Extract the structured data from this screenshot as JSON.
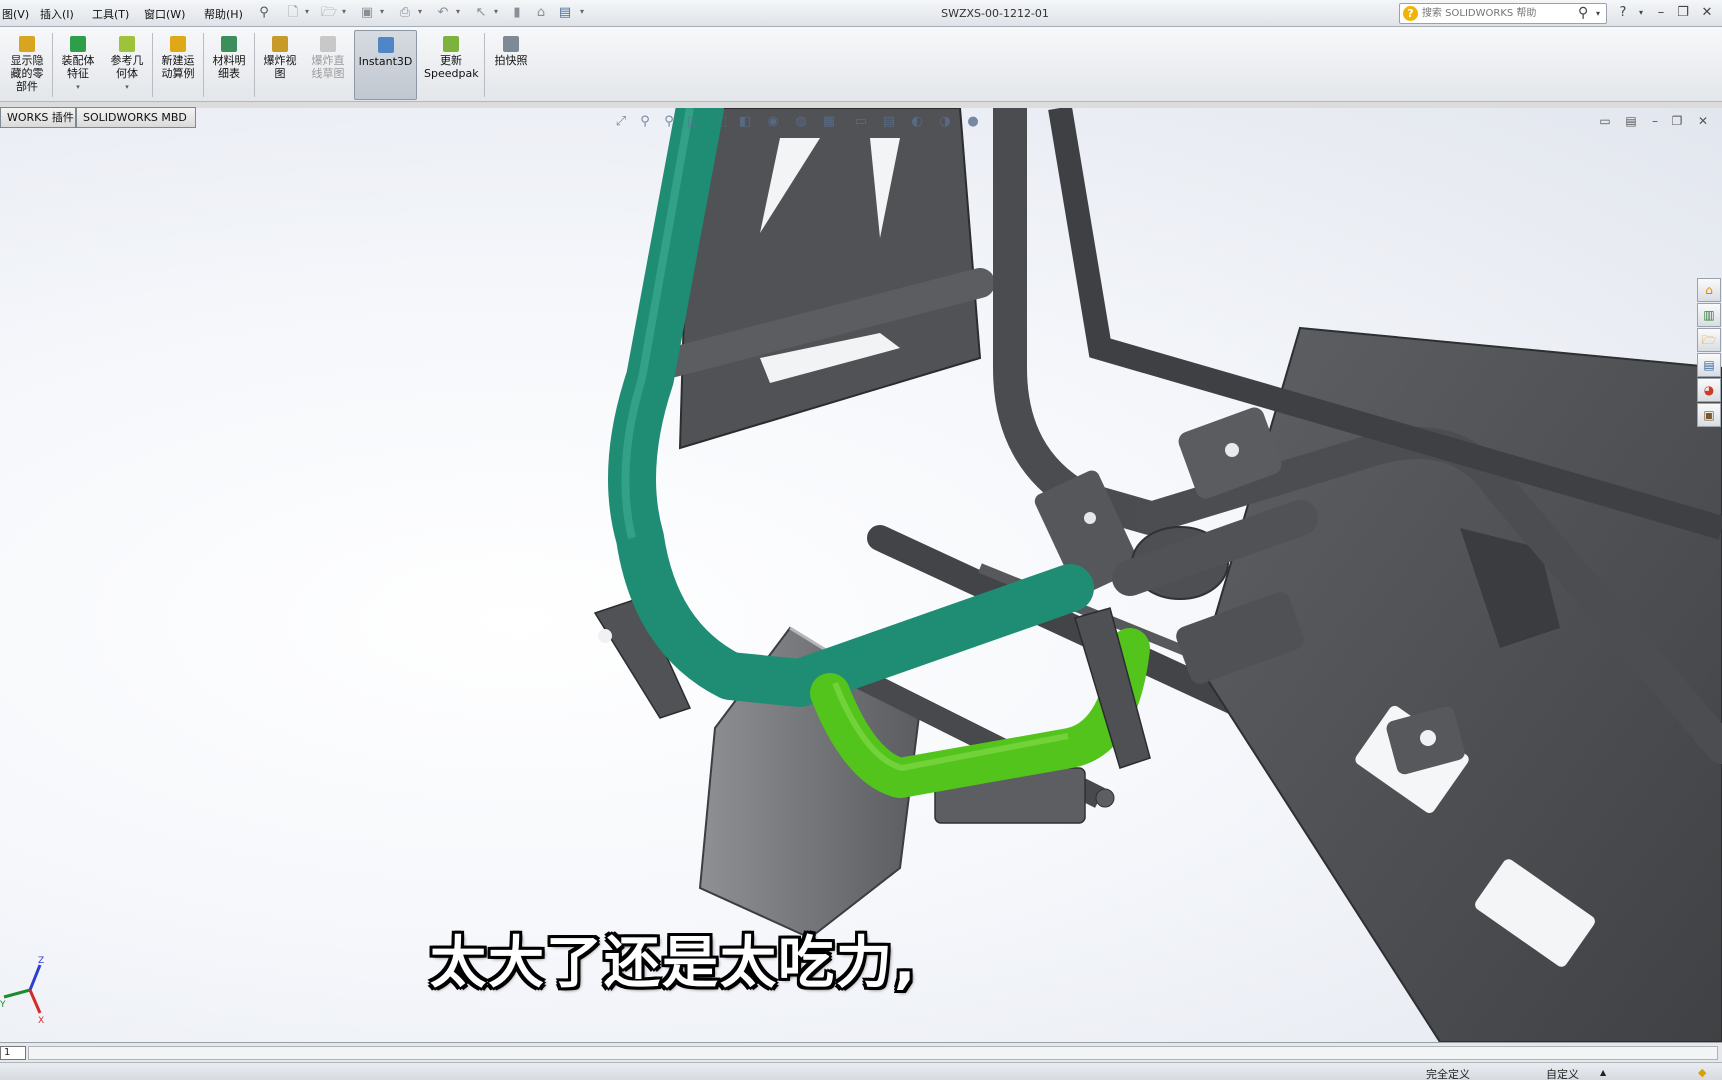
{
  "window": {
    "title": "SWZXS-00-1212-01",
    "menus": [
      "图(V)",
      "插入(I)",
      "工具(T)",
      "窗口(W)",
      "帮助(H)"
    ],
    "search_placeholder": "搜索 SOLIDWORKS 帮助"
  },
  "commands": [
    {
      "label": "显示隐藏的零部件",
      "icon": "show-hidden-components-icon",
      "state": "normal"
    },
    {
      "label": "装配体特征",
      "icon": "assembly-features-icon",
      "state": "normal"
    },
    {
      "label": "参考几何体",
      "icon": "reference-geometry-icon",
      "state": "normal"
    },
    {
      "label": "新建运动算例",
      "icon": "new-motion-study-icon",
      "state": "normal"
    },
    {
      "label": "材料明细表",
      "icon": "bill-of-materials-icon",
      "state": "normal"
    },
    {
      "label": "爆炸视图",
      "icon": "exploded-view-icon",
      "state": "normal"
    },
    {
      "label": "爆炸直线草图",
      "icon": "explode-line-sketch-icon",
      "state": "disabled"
    },
    {
      "label": "Instant3D",
      "icon": "instant3d-icon",
      "state": "active"
    },
    {
      "label": "更新Speedpak",
      "icon": "update-speedpak-icon",
      "state": "normal"
    },
    {
      "label": "拍快照",
      "icon": "take-snapshot-icon",
      "state": "normal"
    }
  ],
  "tabs": [
    "WORKS 插件",
    "SOLIDWORKS MBD"
  ],
  "subtitle": "太大了还是太吃力,",
  "triad": {
    "x": "X",
    "y": "Y",
    "z": "Z"
  },
  "sheet": {
    "page": "1"
  },
  "status": {
    "definition": "完全定义",
    "units": "自定义",
    "units_arrow": "▲"
  },
  "colors": {
    "teal_tube": "#1e8a73",
    "green_tube": "#52c21a",
    "frame_gray": "#4b4d50",
    "plate_gray": "#5b5d60"
  }
}
